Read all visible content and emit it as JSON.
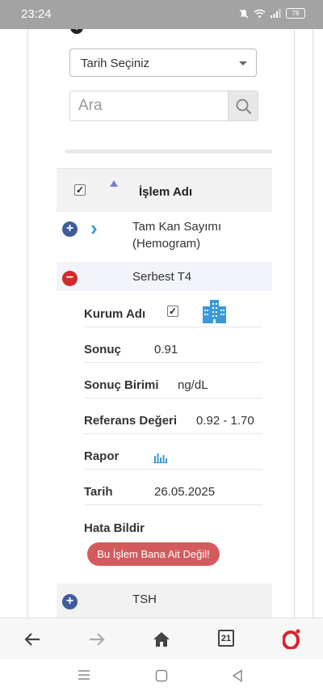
{
  "status_bar": {
    "time": "23:24",
    "battery": "78"
  },
  "filters": {
    "date_select_label": "Tarih Seçiniz",
    "search_placeholder": "Ara"
  },
  "table": {
    "header_label": "İşlem Adı"
  },
  "rows": [
    {
      "name_line1": "Tam Kan Sayımı",
      "name_line2": "(Hemogram)"
    },
    {
      "name": "Serbest T4"
    },
    {
      "name": "TSH"
    }
  ],
  "details": {
    "kurum_label": "Kurum Adı",
    "sonuc_label": "Sonuç",
    "sonuc_value": "0.91",
    "birim_label": "Sonuç Birimi",
    "birim_value": "ng/dL",
    "referans_label": "Referans Değeri",
    "referans_value": "0.92 - 1.70",
    "rapor_label": "Rapor",
    "tarih_label": "Tarih",
    "tarih_value": "26.05.2025",
    "hata_label": "Hata Bildir",
    "report_button": "Bu İşlem Bana Ait Değil!"
  },
  "browser_nav": {
    "calendar_day": "21"
  },
  "icons": [
    "info-icon",
    "chevron-down-icon",
    "search-icon",
    "sort-up-icon",
    "expand-icon",
    "collapse-icon",
    "chevron-right-icon",
    "building-icon",
    "chart-icon",
    "back-icon",
    "forward-icon",
    "home-icon",
    "calendar-icon",
    "opera-icon"
  ],
  "colors": {
    "expand": "#3f5c9a",
    "collapse": "#d22a2a",
    "report_button": "#d35b5e",
    "accent": "#3a9ad9"
  }
}
